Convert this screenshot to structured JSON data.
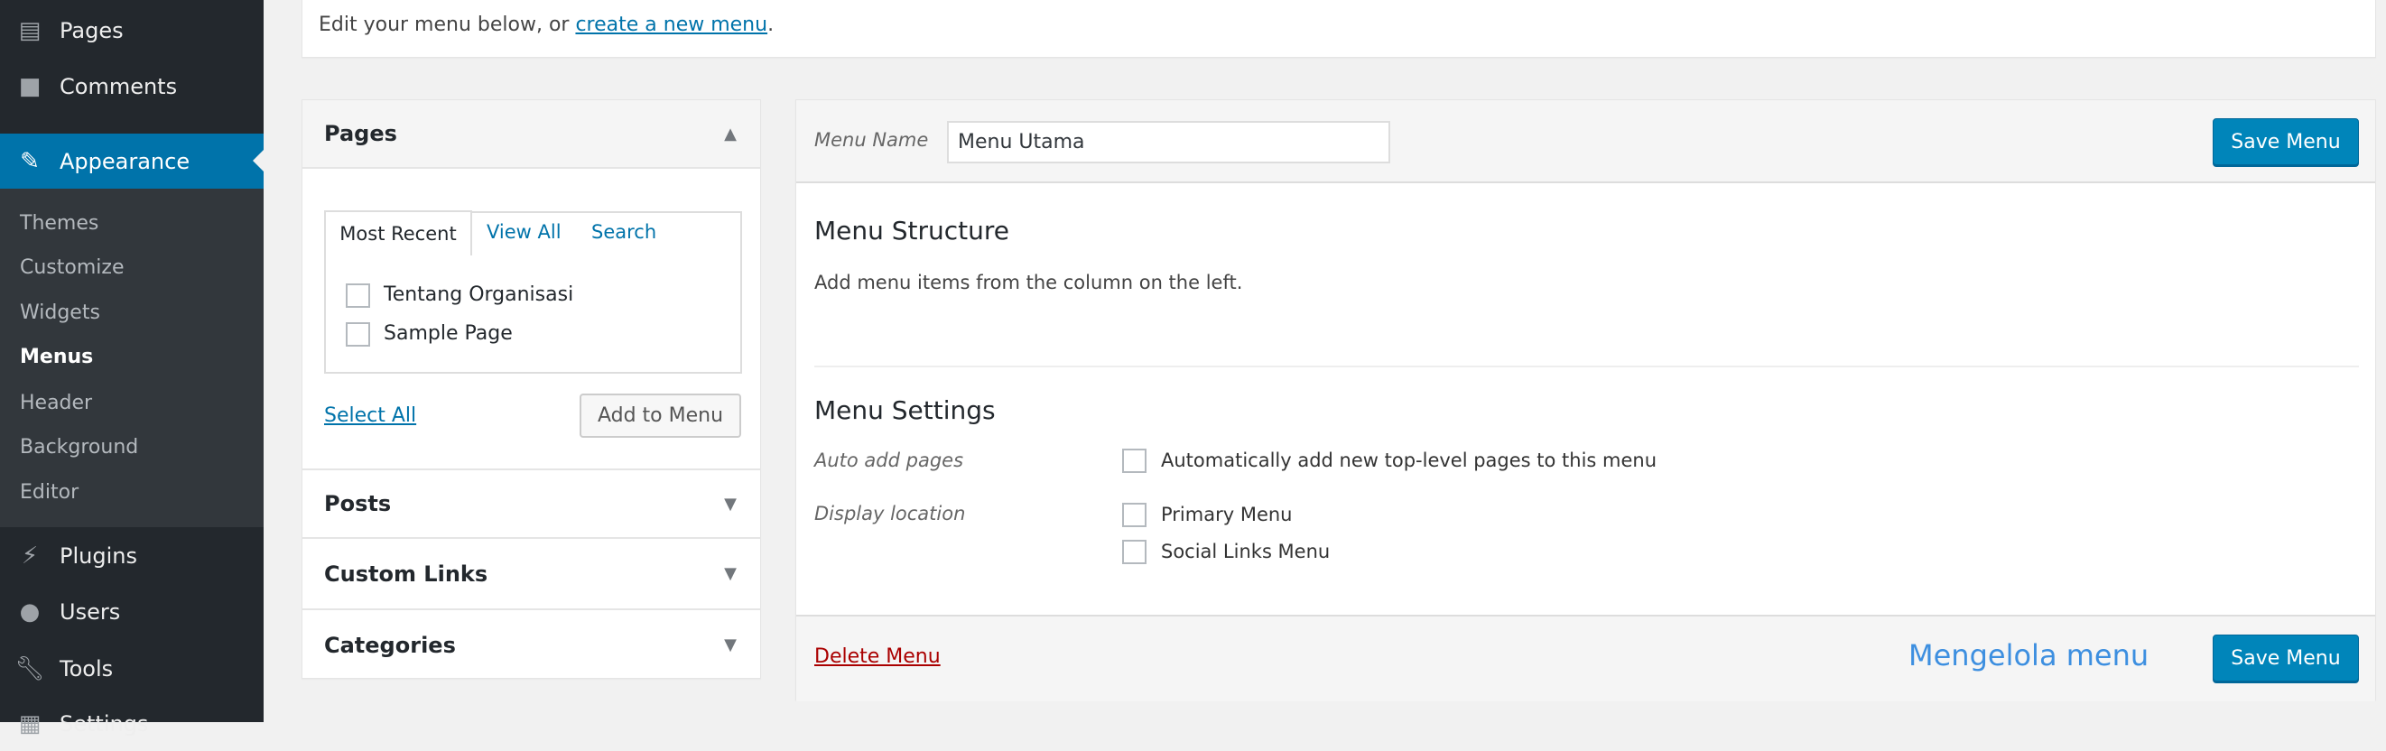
{
  "sidebar": {
    "items": [
      {
        "label": "Pages",
        "icon": "pages-icon"
      },
      {
        "label": "Comments",
        "icon": "comments-icon"
      },
      {
        "label": "Appearance",
        "icon": "paintbrush-icon"
      },
      {
        "label": "Plugins",
        "icon": "plugins-icon"
      },
      {
        "label": "Users",
        "icon": "users-icon"
      },
      {
        "label": "Tools",
        "icon": "tools-icon"
      },
      {
        "label": "Settings",
        "icon": "settings-icon"
      }
    ],
    "submenu": [
      "Themes",
      "Customize",
      "Widgets",
      "Menus",
      "Header",
      "Background",
      "Editor"
    ],
    "current_submenu": "Menus"
  },
  "notice": {
    "text": "Edit your menu below, or ",
    "link": "create a new menu",
    "after": "."
  },
  "left": {
    "pages_title": "Pages",
    "tabs": [
      "Most Recent",
      "View All",
      "Search"
    ],
    "pages": [
      "Tentang Organisasi",
      "Sample Page"
    ],
    "select_all": "Select All",
    "add_button": "Add to Menu",
    "sections": [
      "Posts",
      "Custom Links",
      "Categories"
    ]
  },
  "right": {
    "menu_name_label": "Menu Name",
    "menu_name_value": "Menu Utama",
    "save_label": "Save Menu",
    "structure_title": "Menu Structure",
    "structure_hint": "Add menu items from the column on the left.",
    "settings_title": "Menu Settings",
    "auto_add_label": "Auto add pages",
    "auto_add_option": "Automatically add new top-level pages to this menu",
    "display_location_label": "Display location",
    "locations": [
      "Primary Menu",
      "Social Links Menu"
    ],
    "delete_label": "Delete Menu",
    "caption": "Mengelola menu"
  },
  "colors": {
    "sidebar": "#23282d",
    "accent": "#0073aa",
    "button": "#0085ba",
    "delete": "#a00",
    "caption": "#3d8fe0"
  }
}
